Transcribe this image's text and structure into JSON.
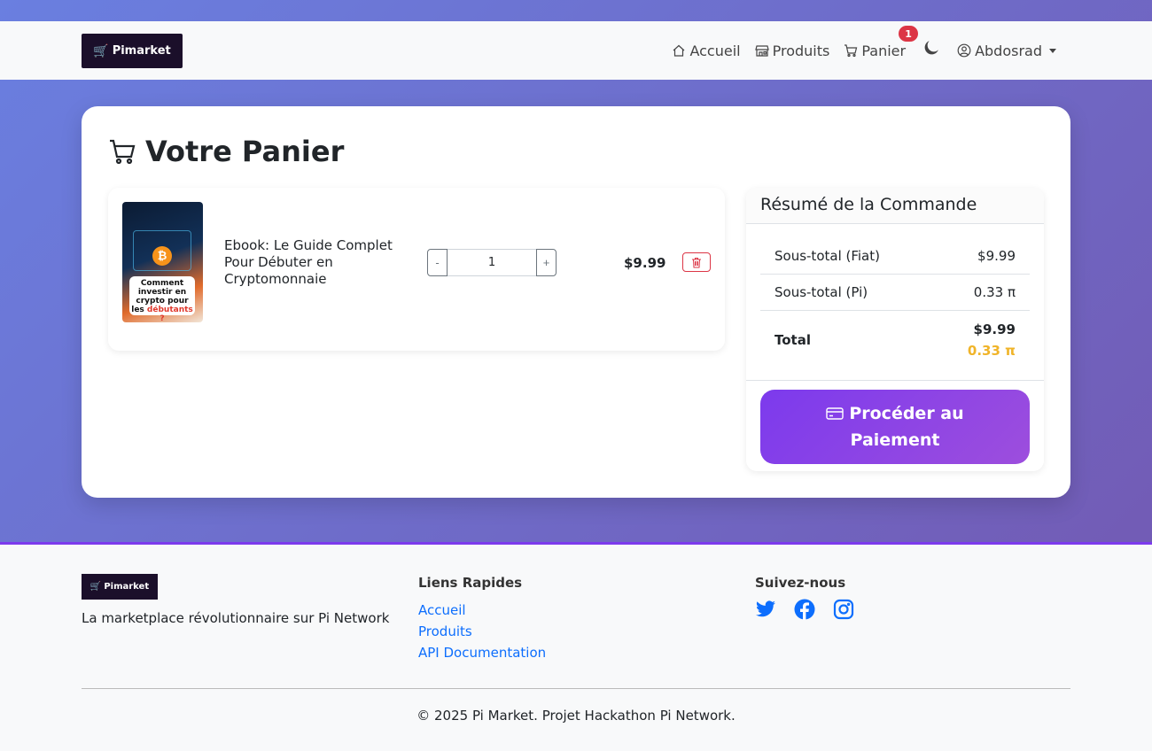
{
  "brand": {
    "name": "Pimarket"
  },
  "nav": {
    "home": "Accueil",
    "products": "Produits",
    "cart": "Panier",
    "cart_count": "1",
    "user": "Abdosrad"
  },
  "page": {
    "title": "Votre Panier"
  },
  "cart_items": [
    {
      "name": "Ebook: Le Guide Complet Pour Débuter en Cryptomonnaie",
      "thumbnail_text_1": "Comment investir en crypto pour les",
      "thumbnail_text_2": "débutants ?",
      "quantity": "1",
      "price": "$9.99",
      "minus": "-",
      "plus": "+"
    }
  ],
  "summary": {
    "title": "Résumé de la Commande",
    "subtotal_fiat_label": "Sous-total (Fiat)",
    "subtotal_fiat_value": "$9.99",
    "subtotal_pi_label": "Sous-total (Pi)",
    "subtotal_pi_value": "0.33 π",
    "total_label": "Total",
    "total_fiat": "$9.99",
    "total_pi": "0.33 π",
    "pay_button": "Procéder au Paiement"
  },
  "footer": {
    "tagline": "La marketplace révolutionnaire sur Pi Network",
    "quick_links_title": "Liens Rapides",
    "links": [
      "Accueil",
      "Produits",
      "API Documentation"
    ],
    "follow_title": "Suivez-nous",
    "copyright": "© 2025 Pi Market. Projet Hackathon Pi Network."
  },
  "colors": {
    "accent": "#7c3aed",
    "link": "#0d6efd",
    "danger": "#dc3545",
    "pi_gold": "#f0b429"
  }
}
